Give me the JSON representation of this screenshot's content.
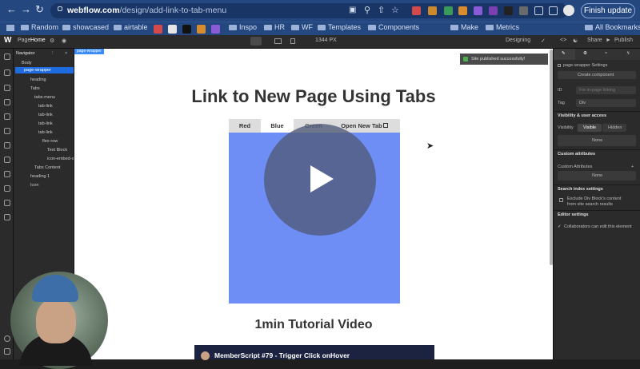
{
  "browser": {
    "url_host": "webflow.com",
    "url_path": "/design/add-link-to-tab-menu",
    "finish_update_label": "Finish update",
    "bookmarks": [
      "Random",
      "showcased",
      "airtable",
      "Inspo",
      "HR",
      "WF",
      "Templates",
      "Components",
      "Make",
      "Metrics"
    ],
    "all_bookmarks_label": "All Bookmarks"
  },
  "designer": {
    "page_label": "Page",
    "page_name": "Home",
    "canvas_width": "1344 PX",
    "mode_label": "Designing",
    "share_label": "Share",
    "publish_label": "Publish"
  },
  "navigator": {
    "title": "Navigator",
    "items": [
      "Body",
      "page-wrapper",
      "heading",
      "Tabs",
      "tabs-menu",
      "tab-link",
      "tab-link",
      "tab-link",
      "tab-link",
      "flex-row",
      "Text Block",
      "icon-embed-x",
      "Tabs Content",
      "heading 1",
      "Icon"
    ]
  },
  "canvas": {
    "selection_badge": "page-wrapper",
    "toast": "Site published successfully!",
    "page_title": "Link to New Page Using Tabs",
    "tabs": [
      "Red",
      "Blue",
      "Green",
      "Open New Tab"
    ],
    "active_tab": "Blue",
    "tutorial_title": "1min Tutorial Video",
    "video_title": "MemberScript #79 - Trigger Click onHover",
    "colors": {
      "tab_pane": "#6e8ef5",
      "selection": "#1f6ce0"
    }
  },
  "right_panel": {
    "element_settings": "page-wrapper Settings",
    "create_component": "Create component",
    "id_label": "ID",
    "id_placeholder": "For in-page linking",
    "tag_label": "Tag",
    "tag_value": "Div",
    "visibility_heading": "Visibility & user access",
    "visibility_label": "Visibility",
    "visible_option": "Visible",
    "hidden_option": "Hidden",
    "none_label": "None",
    "custom_attributes_heading": "Custom attributes",
    "custom_attributes_label": "Custom Attributes",
    "none_label_2": "None",
    "search_index_heading": "Search index settings",
    "search_index_text_1": "Exclude Div Block's content",
    "search_index_text_2": "from site search results",
    "editor_heading": "Editor settings",
    "editor_text": "Collaborators can edit this element"
  }
}
